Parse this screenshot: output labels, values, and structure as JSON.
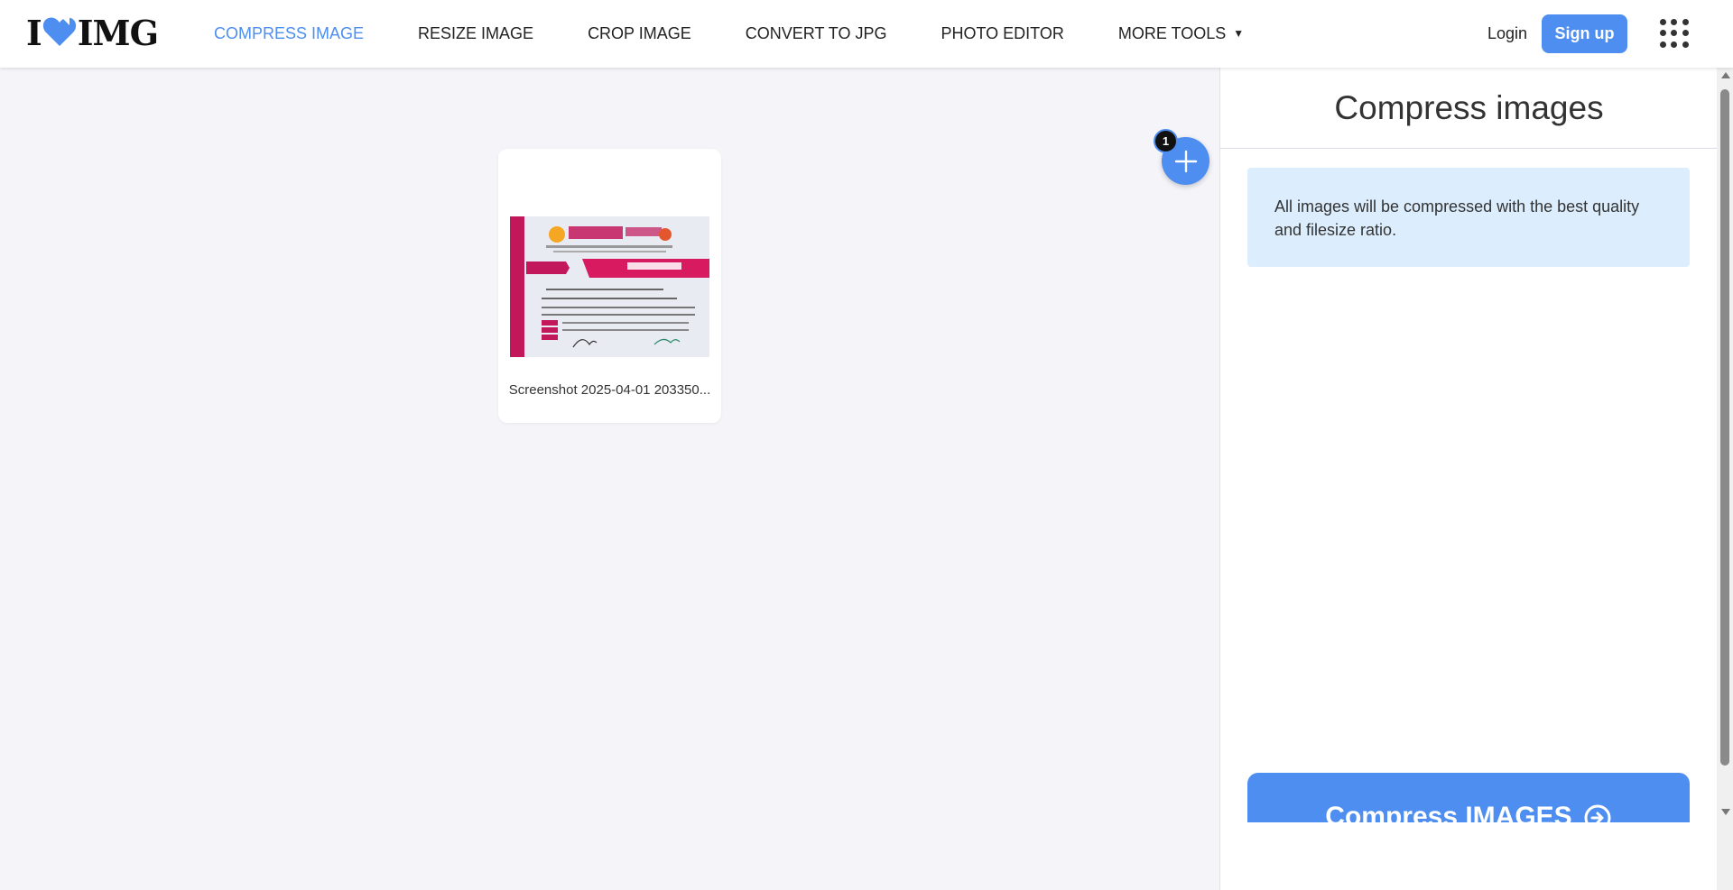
{
  "brand": {
    "logo_left": "I",
    "logo_right": "IMG",
    "heart_color": "#4d8ef0"
  },
  "nav": {
    "items": [
      {
        "label": "COMPRESS IMAGE",
        "active": true
      },
      {
        "label": "RESIZE IMAGE",
        "active": false
      },
      {
        "label": "CROP IMAGE",
        "active": false
      },
      {
        "label": "CONVERT TO JPG",
        "active": false
      },
      {
        "label": "PHOTO EDITOR",
        "active": false
      },
      {
        "label": "MORE TOOLS",
        "active": false
      }
    ],
    "more_caret_icon": "caret-down-icon"
  },
  "auth": {
    "login_label": "Login",
    "signup_label": "Sign up"
  },
  "workspace": {
    "file": {
      "name": "Screenshot 2025-04-01 203350..."
    },
    "file_count": "1",
    "add_icon": "plus-icon"
  },
  "sidebar": {
    "title": "Compress images",
    "info_text": "All images will be compressed with the best quality and filesize ratio.",
    "action_label": "Compress IMAGES",
    "action_icon": "arrow-circle-right-icon"
  },
  "colors": {
    "accent": "#4d8ef0",
    "info_bg": "#dceefd",
    "workspace_bg": "#f4f4f9"
  }
}
